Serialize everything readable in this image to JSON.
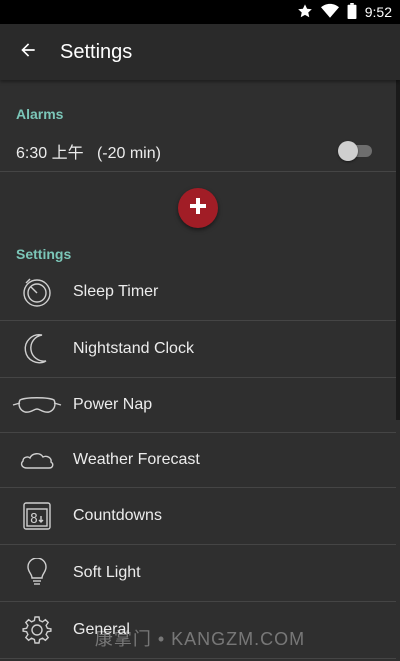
{
  "status_bar": {
    "time": "9:52"
  },
  "app_bar": {
    "title": "Settings"
  },
  "alarms": {
    "header": "Alarms",
    "items": [
      {
        "time": "6:30 上午",
        "offset": "(-20 min)",
        "enabled": false
      }
    ]
  },
  "settings": {
    "header": "Settings",
    "items": [
      {
        "label": "Sleep Timer",
        "icon": "sleep-timer-icon"
      },
      {
        "label": "Nightstand Clock",
        "icon": "moon-icon"
      },
      {
        "label": "Power Nap",
        "icon": "sleep-mask-icon"
      },
      {
        "label": "Weather Forecast",
        "icon": "cloud-icon"
      },
      {
        "label": "Countdowns",
        "icon": "calendar-countdown-icon"
      },
      {
        "label": "Soft Light",
        "icon": "lightbulb-icon"
      },
      {
        "label": "General",
        "icon": "gear-icon"
      }
    ]
  },
  "watermark": "康掌门 • KANGZM.COM",
  "colors": {
    "accent": "#7bc6b8",
    "add_button": "#a11d26",
    "background": "#2f2f2f",
    "app_bar": "#2a2a2a"
  }
}
